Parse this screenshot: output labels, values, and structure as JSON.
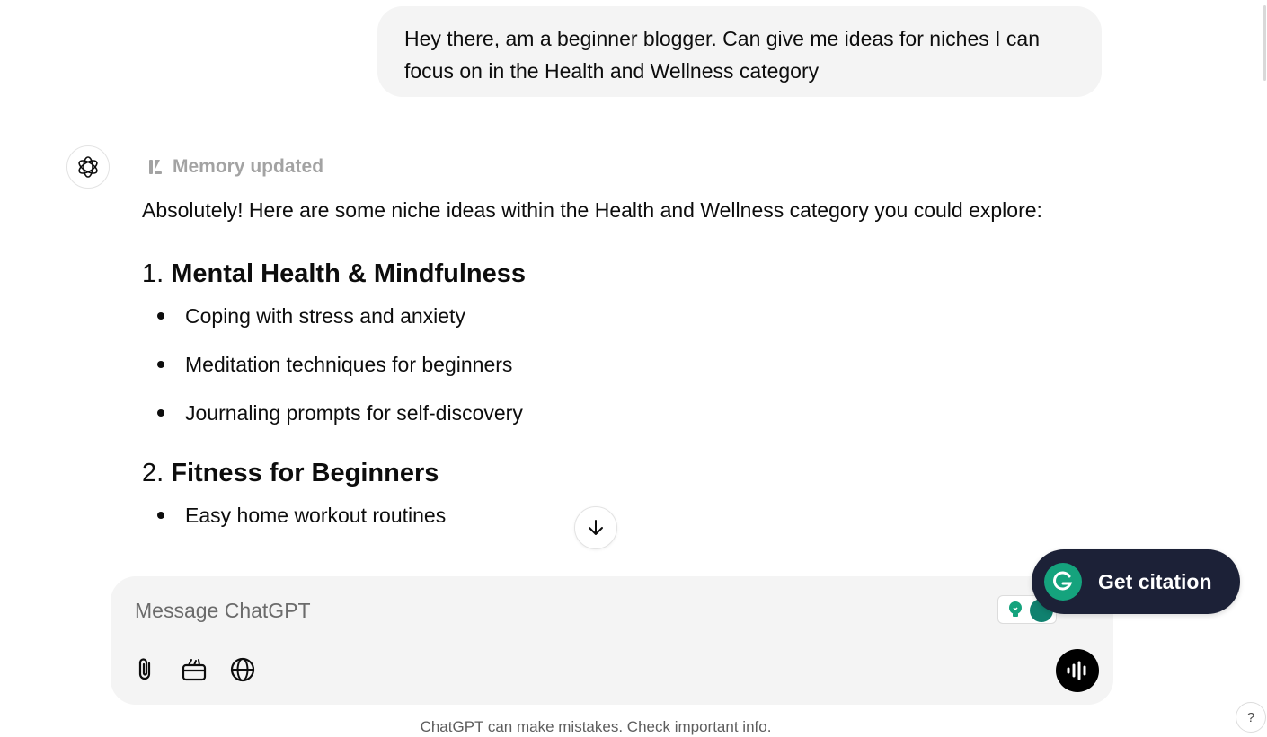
{
  "conversation": {
    "user_message": "Hey there, am a beginner blogger. Can give me ideas for niches I can focus on in the Health and Wellness category",
    "assistant": {
      "memory_status": "Memory updated",
      "intro": "Absolutely! Here are some niche ideas within the Health and Wellness category you could explore:",
      "sections": [
        {
          "number": "1.",
          "title": "Mental Health & Mindfulness",
          "items": [
            "Coping with stress and anxiety",
            "Meditation techniques for beginners",
            "Journaling prompts for self-discovery"
          ]
        },
        {
          "number": "2.",
          "title": "Fitness for Beginners",
          "items": [
            "Easy home workout routines"
          ]
        }
      ]
    }
  },
  "composer": {
    "placeholder": "Message ChatGPT",
    "value": ""
  },
  "citation_widget": {
    "label": "Get citation"
  },
  "footer": {
    "disclaimer": "ChatGPT can make mistakes. Check important info.",
    "help_label": "?"
  },
  "icons": {
    "avatar": "openai-logo-icon",
    "memory": "memory-icon",
    "scroll_down": "arrow-down-icon",
    "attach": "paperclip-icon",
    "tools": "toolbox-icon",
    "web": "globe-icon",
    "voice": "voice-waveform-icon",
    "grammarly": "grammarly-icon"
  },
  "colors": {
    "user_bubble": "#f4f4f4",
    "composer": "#f4f4f4",
    "text": "#0d0d0d",
    "muted_text": "#a3a3a3",
    "citation_bg": "#1c2137",
    "grammarly_green": "#15a37d"
  }
}
